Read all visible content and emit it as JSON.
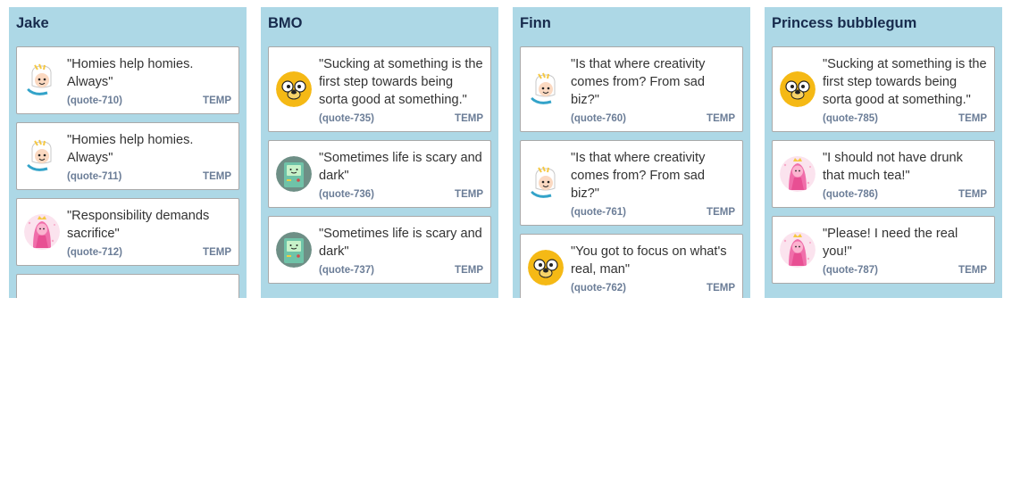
{
  "columns": [
    {
      "title": "Jake",
      "cards": [
        {
          "avatar": "finn-avatar-icon",
          "text": "\"Homies help homies. Always\"",
          "id": "(quote-710)",
          "tag": "TEMP"
        },
        {
          "avatar": "finn-avatar-icon",
          "text": "\"Homies help homies. Always\"",
          "id": "(quote-711)",
          "tag": "TEMP"
        },
        {
          "avatar": "princess-bubblegum-avatar-icon",
          "text": "\"Responsibility demands sacrifice\"",
          "id": "(quote-712)",
          "tag": "TEMP"
        },
        {
          "avatar": "",
          "text": "",
          "id": "",
          "tag": ""
        }
      ]
    },
    {
      "title": "BMO",
      "cards": [
        {
          "avatar": "jake-avatar-icon",
          "text": "\"Sucking at something is the first step towards being sorta good at something.\"",
          "id": "(quote-735)",
          "tag": "TEMP"
        },
        {
          "avatar": "bmo-avatar-icon",
          "text": "\"Sometimes life is scary and dark\"",
          "id": "(quote-736)",
          "tag": "TEMP"
        },
        {
          "avatar": "bmo-avatar-icon",
          "text": "\"Sometimes life is scary and dark\"",
          "id": "(quote-737)",
          "tag": "TEMP"
        }
      ]
    },
    {
      "title": "Finn",
      "cards": [
        {
          "avatar": "finn-avatar-icon",
          "text": "\"Is that where creativity comes from? From sad biz?\"",
          "id": "(quote-760)",
          "tag": "TEMP"
        },
        {
          "avatar": "finn-avatar-icon",
          "text": "\"Is that where creativity comes from? From sad biz?\"",
          "id": "(quote-761)",
          "tag": "TEMP"
        },
        {
          "avatar": "jake-avatar-icon",
          "text": "\"You got to focus on what's real, man\"",
          "id": "(quote-762)",
          "tag": "TEMP"
        },
        {
          "avatar": "",
          "text": "",
          "id": "",
          "tag": ""
        }
      ]
    },
    {
      "title": "Princess bubblegum",
      "cards": [
        {
          "avatar": "jake-avatar-icon",
          "text": "\"Sucking at something is the first step towards being sorta good at something.\"",
          "id": "(quote-785)",
          "tag": "TEMP"
        },
        {
          "avatar": "princess-bubblegum-avatar-icon",
          "text": "\"I should not have drunk that much tea!\"",
          "id": "(quote-786)",
          "tag": "TEMP"
        },
        {
          "avatar": "princess-bubblegum-avatar-icon",
          "text": "\"Please! I need the real you!\"",
          "id": "(quote-787)",
          "tag": "TEMP"
        }
      ]
    }
  ],
  "colors": {
    "column_bg": "#add8e6",
    "title_text": "#172b4d",
    "meta_text": "#6b7d97",
    "card_border": "#a9a9a9"
  }
}
